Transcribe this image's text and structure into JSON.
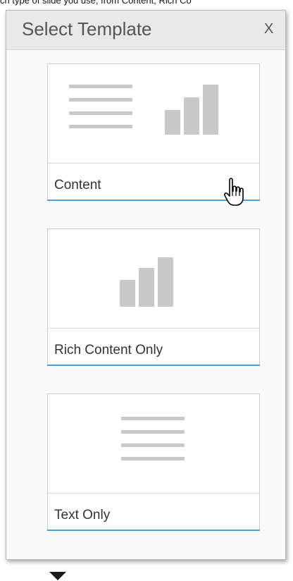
{
  "caption": {
    "text": "ch type of slide you use, from Content, Rich Co"
  },
  "dialog": {
    "title": "Select Template",
    "close_label": "X"
  },
  "templates": [
    {
      "label": "Content",
      "thumbnail": "lines-and-bars-icon"
    },
    {
      "label": "Rich Content Only",
      "thumbnail": "bars-icon"
    },
    {
      "label": "Text Only",
      "thumbnail": "lines-icon"
    }
  ],
  "colors": {
    "accent": "#4aa3d8",
    "placeholder_gray": "#c9c9c9",
    "header_bg": "#e9e9e9"
  },
  "cursor": "hand-pointer-icon"
}
